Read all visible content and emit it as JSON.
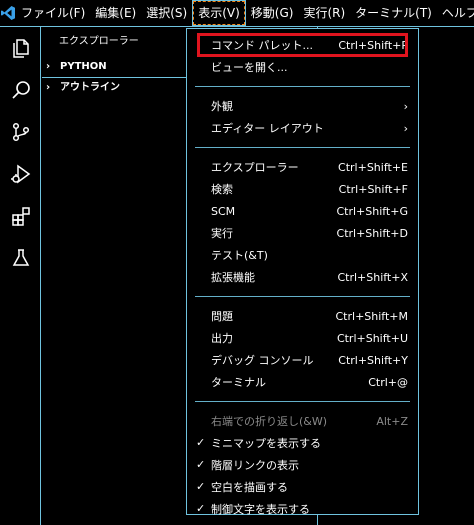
{
  "menubar": {
    "items": [
      "ファイル(F)",
      "編集(E)",
      "選択(S)",
      "表示(V)",
      "移動(G)",
      "実行(R)",
      "ターミナル(T)",
      "ヘルプ(H)"
    ],
    "active_index": 3
  },
  "activitybar": {
    "icons": [
      "explorer-icon",
      "search-icon",
      "source-control-icon",
      "run-debug-icon",
      "extensions-icon",
      "testing-icon"
    ]
  },
  "sidebar": {
    "title": "エクスプローラー",
    "sections": [
      "PYTHON",
      "アウトライン"
    ]
  },
  "dropdown": {
    "groups": [
      [
        {
          "label": "コマンド パレット...",
          "shortcut": "Ctrl+Shift+P"
        },
        {
          "label": "ビューを開く...",
          "shortcut": ""
        }
      ],
      [
        {
          "label": "外観",
          "shortcut": "",
          "submenu": true
        },
        {
          "label": "エディター レイアウト",
          "shortcut": "",
          "submenu": true
        }
      ],
      [
        {
          "label": "エクスプローラー",
          "shortcut": "Ctrl+Shift+E"
        },
        {
          "label": "検索",
          "shortcut": "Ctrl+Shift+F"
        },
        {
          "label": "SCM",
          "shortcut": "Ctrl+Shift+G"
        },
        {
          "label": "実行",
          "shortcut": "Ctrl+Shift+D"
        },
        {
          "label": "テスト(&T)",
          "shortcut": ""
        },
        {
          "label": "拡張機能",
          "shortcut": "Ctrl+Shift+X"
        }
      ],
      [
        {
          "label": "問題",
          "shortcut": "Ctrl+Shift+M"
        },
        {
          "label": "出力",
          "shortcut": "Ctrl+Shift+U"
        },
        {
          "label": "デバッグ コンソール",
          "shortcut": "Ctrl+Shift+Y"
        },
        {
          "label": "ターミナル",
          "shortcut": "Ctrl+@"
        }
      ],
      [
        {
          "label": "右端での折り返し(&W)",
          "shortcut": "Alt+Z",
          "disabled": true
        },
        {
          "label": "ミニマップを表示する",
          "shortcut": "",
          "checked": true
        },
        {
          "label": "階層リンクの表示",
          "shortcut": "",
          "checked": true
        },
        {
          "label": "空白を描画する",
          "shortcut": "",
          "checked": true
        },
        {
          "label": "制御文字を表示する",
          "shortcut": "",
          "checked": true
        }
      ]
    ],
    "submenu_glyph": "›",
    "check_glyph": "✓"
  },
  "colors": {
    "border": "#6fc3df",
    "focus": "#f38518",
    "highlight": "#e0141e"
  }
}
